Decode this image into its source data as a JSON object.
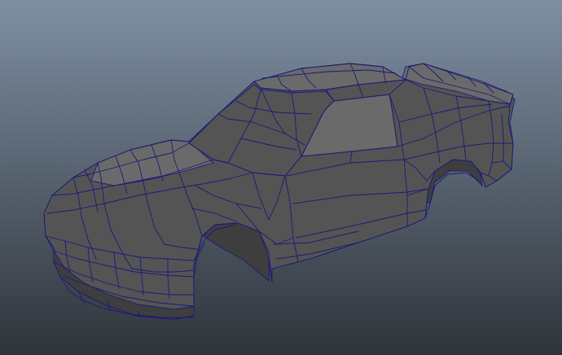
{
  "viewport": {
    "background_top": "#7e8fa3",
    "background_bottom": "#2f343a"
  },
  "model": {
    "surface_color": "#545454",
    "surface_shadow": "#3e3e3e",
    "highlight_color": "#6a6a6a",
    "wire_color": "#1c1a78",
    "wire_highlight": "#2a2ab8"
  }
}
